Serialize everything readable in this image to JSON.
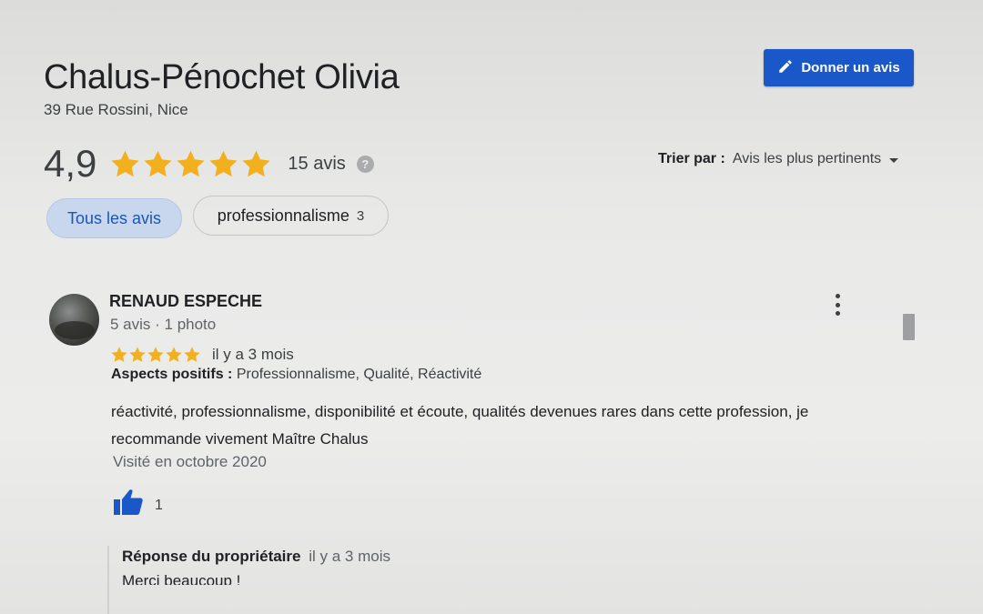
{
  "place": {
    "name": "Chalus-Pénochet Olivia",
    "address": "39 Rue Rossini, Nice"
  },
  "write_review": {
    "label": "Donner un avis",
    "icon": "pencil-icon",
    "color": "#1a57c8"
  },
  "summary": {
    "rating": "4,9",
    "stars_filled": 5,
    "stars_total": 5,
    "review_count": "15 avis",
    "help_icon": "?",
    "star_color": "#f2b01e"
  },
  "sort": {
    "label": "Trier par :",
    "value": "Avis les plus pertinents"
  },
  "filters": [
    {
      "label": "Tous les avis",
      "count": "",
      "selected": true
    },
    {
      "label": "professionnalisme",
      "count": "3",
      "selected": false
    }
  ],
  "reviews": [
    {
      "author": "RENAUD ESPECHE",
      "meta": "5 avis · 1 photo",
      "stars": 5,
      "date": "il y a 3 mois",
      "positives_label": "Aspects positifs :",
      "positives_value": "Professionnalisme, Qualité, Réactivité",
      "text": "réactivité, professionnalisme, disponibilité et écoute, qualités devenues rares dans cette profession, je recommande vivement Maître Chalus",
      "visited": "Visité en octobre 2020",
      "likes": "1",
      "owner_reply": {
        "label": "Réponse du propriétaire",
        "date": "il y a 3 mois",
        "text": "Merci beaucoup !"
      }
    }
  ]
}
